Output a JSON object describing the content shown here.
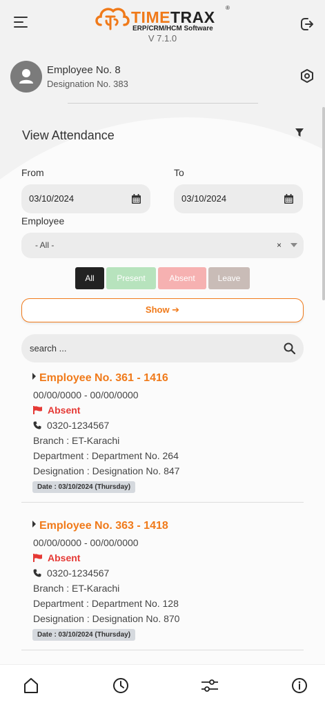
{
  "app": {
    "logo_title": "TIME",
    "logo_title_bold": "TRAX",
    "logo_reg": "®",
    "logo_subtitle": "ERP/CRM/HCM Software",
    "version": "V 7.1.0",
    "brand_color": "#f07a1a"
  },
  "profile": {
    "name": "Employee No. 8",
    "designation": "Designation No. 383"
  },
  "attendance": {
    "title": "View Attendance",
    "from_label": "From",
    "to_label": "To",
    "from_value": "03/10/2024",
    "to_value": "03/10/2024",
    "employee_label": "Employee",
    "employee_value": "- All -",
    "employee_clear": "×",
    "segments": [
      {
        "label": "All",
        "color": "#222222"
      },
      {
        "label": "Present",
        "color": "#b7e3bd"
      },
      {
        "label": "Absent",
        "color": "#f6b1b1"
      },
      {
        "label": "Leave",
        "color": "#c9bcb7"
      }
    ],
    "show_label": "Show ➔",
    "search_placeholder": "search ..."
  },
  "records": [
    {
      "title": "Employee No. 361 - 1416",
      "time": "00/00/0000 - 00/00/0000",
      "status": "Absent",
      "phone": "0320-1234567",
      "branch": "Branch : ET-Karachi",
      "department": "Department : Department No. 264",
      "designation": "Designation : Designation No. 847",
      "date": "Date : 03/10/2024 (Thursday)"
    },
    {
      "title": "Employee No. 363 - 1418",
      "time": "00/00/0000 - 00/00/0000",
      "status": "Absent",
      "phone": "0320-1234567",
      "branch": "Branch : ET-Karachi",
      "department": "Department : Department No. 128",
      "designation": "Designation : Designation No. 870",
      "date": "Date : 03/10/2024 (Thursday)"
    }
  ],
  "nav": [
    "home-icon",
    "clock-icon",
    "sliders-icon",
    "info-icon"
  ]
}
